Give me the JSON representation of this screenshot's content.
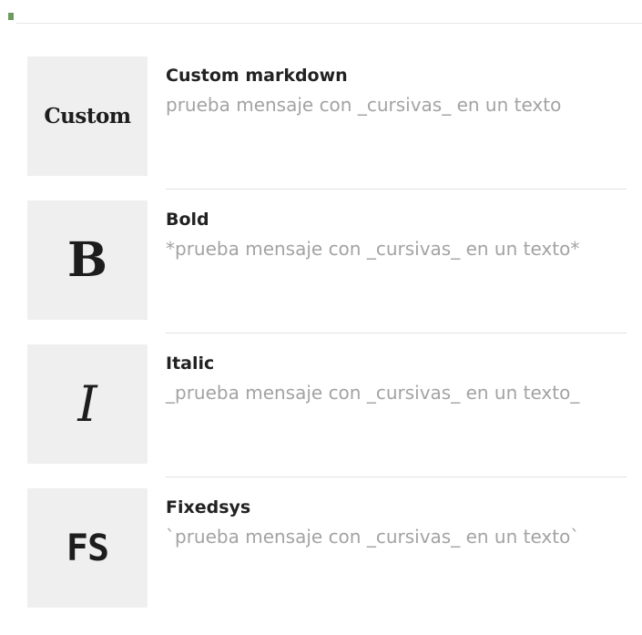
{
  "items": [
    {
      "thumb": "Custom",
      "title": "Custom markdown",
      "desc": "prueba mensaje con _cursivas_ en un texto"
    },
    {
      "thumb": "B",
      "title": "Bold",
      "desc": "*prueba mensaje con _cursivas_ en un texto*"
    },
    {
      "thumb": "I",
      "title": "Italic",
      "desc": "_prueba mensaje con _cursivas_ en un texto_"
    },
    {
      "thumb": "FS",
      "title": "Fixedsys",
      "desc": "`prueba mensaje con _cursivas_ en un texto`"
    }
  ]
}
